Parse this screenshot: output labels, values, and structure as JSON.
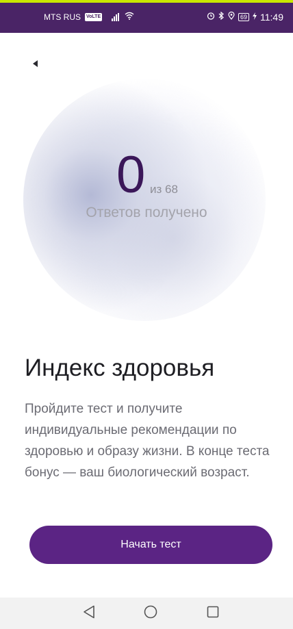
{
  "status_bar": {
    "carrier": "MTS RUS",
    "volte": "VoLTE",
    "battery": "69",
    "time": "11:49",
    "icons": [
      "signal-icon",
      "wifi-icon",
      "alarm-icon",
      "bluetooth-icon",
      "location-icon",
      "battery-icon",
      "charging-icon"
    ]
  },
  "header": {
    "back_icon": "back-arrow-icon"
  },
  "progress": {
    "answered": "0",
    "total_label": "из 68",
    "label": "Ответов получено"
  },
  "content": {
    "title": "Индекс здоровья",
    "description": "Пройдите тест и получите индивидуальные рекомендации по здоровью и образу жизни. В конце теста бонус — ваш биологический возраст."
  },
  "actions": {
    "start_label": "Начать тест"
  },
  "nav_bar": {
    "icons": [
      "nav-back-icon",
      "nav-home-icon",
      "nav-recents-icon"
    ]
  },
  "colors": {
    "status_bar": "#4a2466",
    "accent_top": "#c9e600",
    "counter": "#3b1759",
    "button": "#5b2484",
    "title": "#1e1e23",
    "body_text": "#6b6b73",
    "muted_text": "#a3a3ab",
    "nav_bar": "#f2f2f2"
  }
}
